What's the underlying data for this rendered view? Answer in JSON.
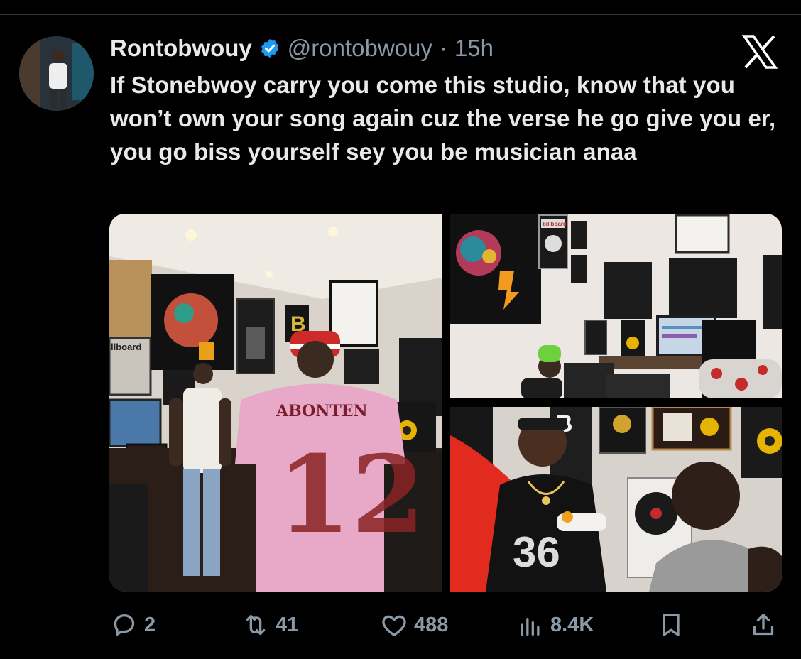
{
  "author": {
    "display_name": "Rontobwouy",
    "handle": "@rontobwouy",
    "separator": "·",
    "time": "15h",
    "verified": true,
    "avatar_icon": "profile-avatar"
  },
  "brand_icon": "x-logo-icon",
  "tweet": {
    "text": "If Stonebwoy carry you come this studio, know that you won’t own your song again cuz the verse he go give you er, you go biss yourself sey you be musician anaa"
  },
  "media": {
    "photo_count": 3,
    "photo1": {
      "jersey_name": "ABONTEN",
      "jersey_number": "12",
      "poster_letter": "B",
      "plaque_text": "llboard"
    },
    "photo2": {
      "plaque_text": "billboard"
    },
    "photo3": {
      "wall_letter": "B"
    }
  },
  "actions": {
    "replies": "2",
    "retweets": "41",
    "likes": "488",
    "views": "8.4K"
  },
  "colors": {
    "background": "#000000",
    "text_primary": "#e7e9ea",
    "text_secondary": "#8b98a5",
    "verified_blue": "#1d9bf0"
  }
}
